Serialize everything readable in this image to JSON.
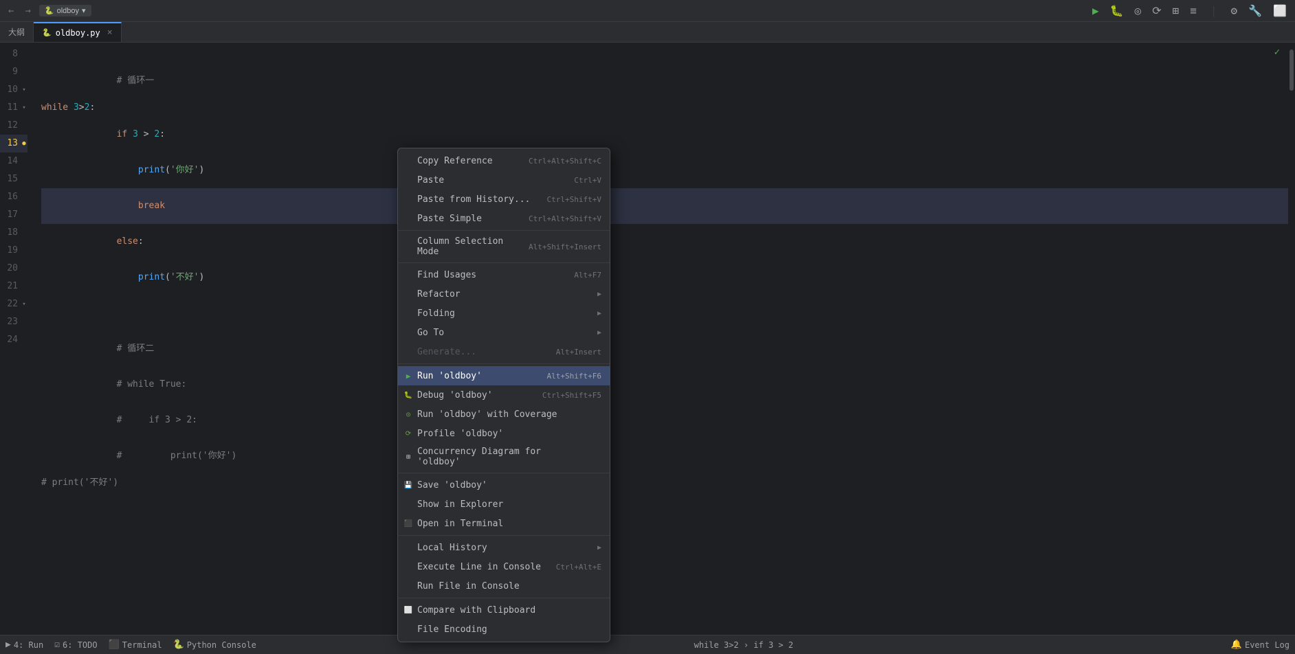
{
  "titlebar": {
    "project_icon": "🐍",
    "project_name": "oldboy",
    "project_dropdown": "▾",
    "nav_back": "←",
    "nav_forward": "→",
    "run_icon": "▶",
    "debug_icon": "🐛",
    "run_coverage_icon": "◎",
    "profile_icon": "⟳",
    "concurrency_icon": "⊞",
    "settings_icon": "⚙",
    "more_icon": "⊡",
    "file_tab": "oldboy.py"
  },
  "breadcrumb": {
    "icon": "🐍",
    "filename": "oldboy.py",
    "close": "×"
  },
  "outline_tab": "大纲",
  "lines": [
    {
      "num": "8",
      "content": "",
      "indent": 0,
      "fold": false
    },
    {
      "num": "9",
      "content": "    # 循环一",
      "indent": 1,
      "fold": false,
      "comment": true
    },
    {
      "num": "10",
      "content": "while 3>2:",
      "indent": 0,
      "fold": true,
      "has_while": true
    },
    {
      "num": "11",
      "content": "    if 3 > 2:",
      "indent": 1,
      "fold": true,
      "has_if": true
    },
    {
      "num": "12",
      "content": "        print('你好')",
      "indent": 2,
      "fold": false
    },
    {
      "num": "13",
      "content": "        break",
      "indent": 2,
      "fold": false,
      "highlighted": true
    },
    {
      "num": "14",
      "content": "    else:",
      "indent": 1,
      "fold": false
    },
    {
      "num": "15",
      "content": "        print('不好')",
      "indent": 2,
      "fold": false
    },
    {
      "num": "16",
      "content": "",
      "indent": 0,
      "fold": false
    },
    {
      "num": "17",
      "content": "",
      "indent": 0,
      "fold": false
    },
    {
      "num": "18",
      "content": "    # 循环二",
      "indent": 1,
      "fold": false,
      "comment": true
    },
    {
      "num": "19",
      "content": "    # while True:",
      "indent": 1,
      "fold": false,
      "comment": true
    },
    {
      "num": "20",
      "content": "    #     if 3 > 2:",
      "indent": 1,
      "fold": false,
      "comment": true
    },
    {
      "num": "21",
      "content": "    #         print('你好')",
      "indent": 1,
      "fold": false,
      "comment": true
    },
    {
      "num": "22",
      "content": "    # print('不好')",
      "indent": 0,
      "fold": true,
      "comment": true
    },
    {
      "num": "23",
      "content": "",
      "indent": 0,
      "fold": false
    },
    {
      "num": "24",
      "content": "",
      "indent": 0,
      "fold": false
    }
  ],
  "context_menu": {
    "items": [
      {
        "id": "copy-reference",
        "label": "Copy Reference",
        "shortcut": "Ctrl+Alt+Shift+C",
        "icon": "",
        "submenu": false,
        "disabled": false,
        "separator_after": false
      },
      {
        "id": "paste",
        "label": "Paste",
        "shortcut": "Ctrl+V",
        "icon": "",
        "submenu": false,
        "disabled": false,
        "separator_after": false
      },
      {
        "id": "paste-history",
        "label": "Paste from History...",
        "shortcut": "Ctrl+Shift+V",
        "icon": "",
        "submenu": false,
        "disabled": false,
        "separator_after": false
      },
      {
        "id": "paste-simple",
        "label": "Paste Simple",
        "shortcut": "Ctrl+Alt+Shift+V",
        "icon": "",
        "submenu": false,
        "disabled": false,
        "separator_after": true
      },
      {
        "id": "column-selection",
        "label": "Column Selection Mode",
        "shortcut": "Alt+Shift+Insert",
        "icon": "",
        "submenu": false,
        "disabled": false,
        "separator_after": true
      },
      {
        "id": "find-usages",
        "label": "Find Usages",
        "shortcut": "Alt+F7",
        "icon": "",
        "submenu": false,
        "disabled": false,
        "separator_after": false
      },
      {
        "id": "refactor",
        "label": "Refactor",
        "shortcut": "",
        "icon": "",
        "submenu": true,
        "disabled": false,
        "separator_after": false
      },
      {
        "id": "folding",
        "label": "Folding",
        "shortcut": "",
        "icon": "",
        "submenu": true,
        "disabled": false,
        "separator_after": false
      },
      {
        "id": "go-to",
        "label": "Go To",
        "shortcut": "",
        "icon": "",
        "submenu": true,
        "disabled": false,
        "separator_after": false
      },
      {
        "id": "generate",
        "label": "Generate...",
        "shortcut": "Alt+Insert",
        "icon": "",
        "submenu": false,
        "disabled": true,
        "separator_after": true
      },
      {
        "id": "run-oldboy",
        "label": "Run 'oldboy'",
        "shortcut": "Alt+Shift+F6",
        "icon": "▶",
        "submenu": false,
        "disabled": false,
        "separator_after": false,
        "highlighted": true
      },
      {
        "id": "debug-oldboy",
        "label": "Debug 'oldboy'",
        "shortcut": "Ctrl+Shift+F5",
        "icon": "🐛",
        "submenu": false,
        "disabled": false,
        "separator_after": false
      },
      {
        "id": "run-with-coverage",
        "label": "Run 'oldboy' with Coverage",
        "shortcut": "",
        "icon": "◎",
        "submenu": false,
        "disabled": false,
        "separator_after": false
      },
      {
        "id": "profile-oldboy",
        "label": "Profile 'oldboy'",
        "shortcut": "",
        "icon": "⟳",
        "submenu": false,
        "disabled": false,
        "separator_after": false
      },
      {
        "id": "concurrency-oldboy",
        "label": "Concurrency Diagram for 'oldboy'",
        "shortcut": "",
        "icon": "⊞",
        "submenu": false,
        "disabled": false,
        "separator_after": true
      },
      {
        "id": "save-oldboy",
        "label": "Save 'oldboy'",
        "shortcut": "",
        "icon": "💾",
        "submenu": false,
        "disabled": false,
        "separator_after": false
      },
      {
        "id": "show-explorer",
        "label": "Show in Explorer",
        "shortcut": "",
        "icon": "",
        "submenu": false,
        "disabled": false,
        "separator_after": false
      },
      {
        "id": "open-terminal",
        "label": "Open in Terminal",
        "shortcut": "",
        "icon": "⬛",
        "submenu": false,
        "disabled": false,
        "separator_after": true
      },
      {
        "id": "local-history",
        "label": "Local History",
        "shortcut": "",
        "icon": "",
        "submenu": true,
        "disabled": false,
        "separator_after": false
      },
      {
        "id": "execute-console",
        "label": "Execute Line in Console",
        "shortcut": "Ctrl+Alt+E",
        "icon": "",
        "submenu": false,
        "disabled": false,
        "separator_after": false
      },
      {
        "id": "run-file-console",
        "label": "Run File in Console",
        "shortcut": "",
        "icon": "",
        "submenu": false,
        "disabled": false,
        "separator_after": true
      },
      {
        "id": "compare-clipboard",
        "label": "Compare with Clipboard",
        "shortcut": "",
        "icon": "⬜",
        "submenu": false,
        "disabled": false,
        "separator_after": false
      },
      {
        "id": "file-encoding",
        "label": "File Encoding",
        "shortcut": "",
        "icon": "",
        "submenu": false,
        "disabled": false,
        "separator_after": false
      }
    ]
  },
  "statusbar": {
    "run_label": "4: Run",
    "todo_label": "6: TODO",
    "terminal_label": "Terminal",
    "python_console_label": "Python Console",
    "event_log_label": "Event Log",
    "breadcrumb_text": "while 3>2  ›  if 3 > 2"
  }
}
